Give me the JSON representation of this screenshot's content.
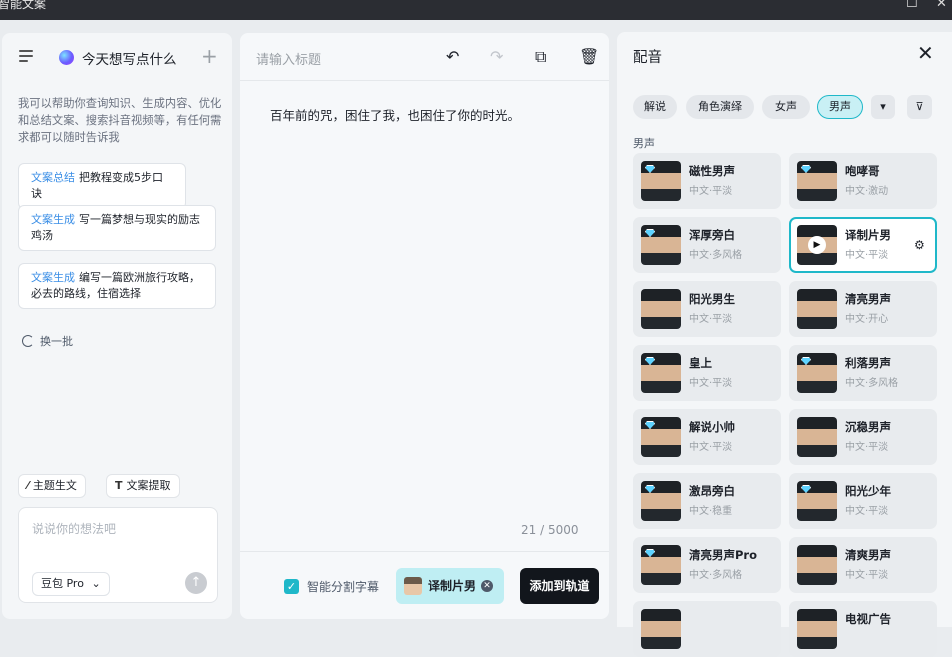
{
  "window": {
    "title": "智能文案",
    "maximize_icon": "square-icon",
    "close_icon": "close-icon"
  },
  "left": {
    "title": "今天想写点什么",
    "intro": "我可以帮助你查询知识、生成内容、优化和总结文案、搜索抖音视频等，有任何需求都可以随时告诉我",
    "suggestions": [
      {
        "tag": "文案总结",
        "text": "把教程变成5步口诀"
      },
      {
        "tag": "文案生成",
        "text": "写一篇梦想与现实的励志鸡汤"
      },
      {
        "tag": "文案生成",
        "text": "编写一篇欧洲旅行攻略，必去的路线，住宿选择"
      }
    ],
    "refresh_label": "换一批",
    "chips": [
      {
        "label": "主题生文"
      },
      {
        "label": "文案提取"
      }
    ],
    "input_placeholder": "说说你的想法吧",
    "model": "豆包 Pro"
  },
  "editor": {
    "title_placeholder": "请输入标题",
    "content": "百年前的咒，困住了我，也困住了你的时光。",
    "counter": "21 / 5000",
    "split_label": "智能分割字幕",
    "split_checked": true,
    "selected_voice": "译制片男",
    "add_label": "添加到轨道"
  },
  "voice_panel": {
    "title": "配音",
    "filters": [
      "解说",
      "角色演绎",
      "女声",
      "男声"
    ],
    "active_filter": "男声",
    "section": "男声",
    "voices": [
      {
        "name": "磁性男声",
        "desc": "中文·平淡",
        "premium": true
      },
      {
        "name": "咆哮哥",
        "desc": "中文·激动",
        "premium": true
      },
      {
        "name": "浑厚旁白",
        "desc": "中文·多风格",
        "premium": true
      },
      {
        "name": "译制片男",
        "desc": "中文·平淡",
        "premium": false,
        "selected": true
      },
      {
        "name": "阳光男生",
        "desc": "中文·平淡",
        "premium": false
      },
      {
        "name": "清亮男声",
        "desc": "中文·开心",
        "premium": false
      },
      {
        "name": "皇上",
        "desc": "中文·平淡",
        "premium": true
      },
      {
        "name": "利落男声",
        "desc": "中文·多风格",
        "premium": true
      },
      {
        "name": "解说小帅",
        "desc": "中文·平淡",
        "premium": true
      },
      {
        "name": "沉稳男声",
        "desc": "中文·平淡",
        "premium": false
      },
      {
        "name": "激昂旁白",
        "desc": "中文·稳重",
        "premium": true
      },
      {
        "name": "阳光少年",
        "desc": "中文·平淡",
        "premium": true
      },
      {
        "name": "清亮男声Pro",
        "desc": "中文·多风格",
        "premium": true
      },
      {
        "name": "清爽男声",
        "desc": "中文·平淡",
        "premium": false
      },
      {
        "name": "",
        "desc": "",
        "premium": false
      },
      {
        "name": "电视广告",
        "desc": "",
        "premium": false
      }
    ],
    "colors": {
      "accent": "#1fb8c9",
      "selected_bg": "#c9f0f5"
    }
  }
}
